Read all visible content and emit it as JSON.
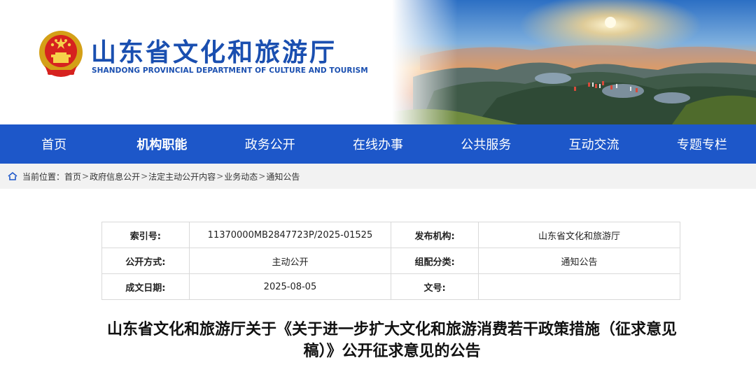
{
  "header": {
    "title_cn": "山东省文化和旅游厅",
    "title_en": "SHANDONG PROVINCIAL DEPARTMENT OF CULTURE AND  TOURISM"
  },
  "nav": {
    "items": [
      {
        "label": "首页",
        "active": false
      },
      {
        "label": "机构职能",
        "active": true
      },
      {
        "label": "政务公开",
        "active": false
      },
      {
        "label": "在线办事",
        "active": false
      },
      {
        "label": "公共服务",
        "active": false
      },
      {
        "label": "互动交流",
        "active": false
      },
      {
        "label": "专题专栏",
        "active": false
      }
    ],
    "color": "#1d57c9"
  },
  "breadcrumb": {
    "prefix": "当前位置：",
    "items": [
      "首页",
      "政府信息公开",
      "法定主动公开内容",
      "业务动态",
      "通知公告"
    ],
    "separator": ">"
  },
  "meta": {
    "rows": [
      {
        "k1": "索引号:",
        "v1": "11370000MB2847723P/2025-01525",
        "k2": "发布机构:",
        "v2": "山东省文化和旅游厅"
      },
      {
        "k1": "公开方式:",
        "v1": "主动公开",
        "k2": "组配分类:",
        "v2": "通知公告"
      },
      {
        "k1": "成文日期:",
        "v1": "2025-08-05",
        "k2": "文号:",
        "v2": ""
      }
    ]
  },
  "article": {
    "title": "山东省文化和旅游厅关于《关于进一步扩大文化和旅游消费若干政策措施（征求意见稿）》公开征求意见的公告"
  }
}
